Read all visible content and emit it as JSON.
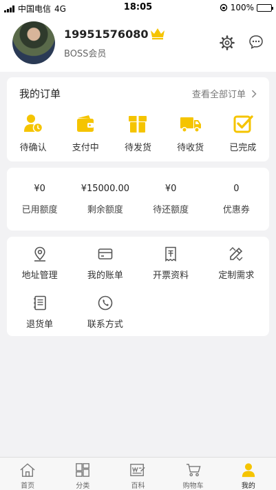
{
  "status_bar": {
    "carrier": "中国电信",
    "network": "4G",
    "time": "18:05",
    "battery": "100%"
  },
  "profile": {
    "phone": "19951576080",
    "member_level": "BOSS会员"
  },
  "orders": {
    "title": "我的订单",
    "view_all": "查看全部订单",
    "items": [
      {
        "label": "待确认",
        "icon": "pending-confirm-icon"
      },
      {
        "label": "支付中",
        "icon": "wallet-icon"
      },
      {
        "label": "待发货",
        "icon": "gift-box-icon"
      },
      {
        "label": "待收货",
        "icon": "truck-icon"
      },
      {
        "label": "已完成",
        "icon": "checkbox-icon"
      }
    ]
  },
  "quota": {
    "items": [
      {
        "value": "¥0",
        "label": "已用额度"
      },
      {
        "value": "¥15000.00",
        "label": "剩余额度"
      },
      {
        "value": "¥0",
        "label": "待还额度"
      },
      {
        "value": "0",
        "label": "优惠券"
      }
    ]
  },
  "services": {
    "items": [
      {
        "label": "地址管理",
        "icon": "location-pin-icon"
      },
      {
        "label": "我的账单",
        "icon": "card-icon"
      },
      {
        "label": "开票资料",
        "icon": "invoice-icon"
      },
      {
        "label": "定制需求",
        "icon": "pencil-ruler-icon"
      },
      {
        "label": "退货单",
        "icon": "notebook-icon"
      },
      {
        "label": "联系方式",
        "icon": "phone-icon"
      }
    ]
  },
  "tabbar": {
    "items": [
      {
        "label": "首页",
        "icon": "home-icon"
      },
      {
        "label": "分类",
        "icon": "category-icon"
      },
      {
        "label": "百科",
        "icon": "encyclopedia-icon"
      },
      {
        "label": "购物车",
        "icon": "cart-icon"
      },
      {
        "label": "我的",
        "icon": "user-icon"
      }
    ],
    "active_index": 4
  },
  "colors": {
    "accent": "#f5c400",
    "background": "#f2f2f4",
    "card": "#ffffff"
  }
}
